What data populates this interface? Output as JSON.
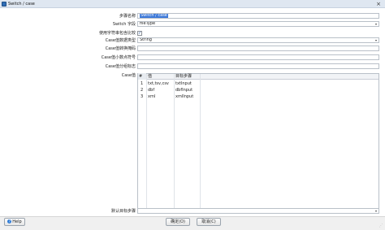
{
  "window": {
    "title": "Switch / case"
  },
  "form": {
    "step_name_label": "步骤名称",
    "step_name_value": "Switch / case",
    "switch_field_label": "Switch 字段",
    "switch_field_value": "fileType",
    "use_contains_label": "使用字符串包含比较",
    "use_contains_checked": "✓",
    "case_value_type_label": "Case值数据类型",
    "case_value_type_value": "String",
    "case_conversion_mask_label": "Case值转换掩码",
    "case_decimal_symbol_label": "Case值小数点符号",
    "case_grouping_symbol_label": "Case值分组标志",
    "case_values_label": "Case值",
    "default_target_label": "默认目标步骤"
  },
  "grid": {
    "columns": [
      "#",
      "值",
      "目标步骤"
    ],
    "rows": [
      {
        "num": "1",
        "value": "txt,tsv,csv",
        "target": "txtInput"
      },
      {
        "num": "2",
        "value": "dbf",
        "target": "dbfInput"
      },
      {
        "num": "3",
        "value": "xml",
        "target": "xmlInput"
      }
    ]
  },
  "buttons": {
    "help": "Help",
    "ok": "确定(O)",
    "cancel": "取消(C)"
  }
}
